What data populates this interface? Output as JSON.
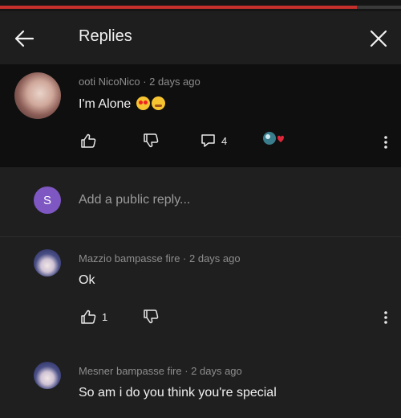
{
  "header": {
    "title": "Replies",
    "back_icon": "arrow-left-icon",
    "close_icon": "close-icon"
  },
  "video_progress": {
    "played_fraction": 0.89
  },
  "parent_comment": {
    "meta": "ooti NicoNico · 2 days ago",
    "text": "I'm Alone",
    "emojis": [
      "heart-eyes-emoji",
      "hot-face-emoji"
    ],
    "reply_count": "4"
  },
  "reply_input": {
    "avatar_letter": "S",
    "placeholder": "Add a public reply..."
  },
  "replies": [
    {
      "meta": "Mazzio bampasse fire · 2 days ago",
      "text": "Ok",
      "like_count": "1"
    },
    {
      "meta": "Mesner bampasse fire · 2 days ago",
      "text": "So am i do you think you're special"
    }
  ],
  "colors": {
    "background": "#1f1f1f",
    "parent_background": "#0f0f0f",
    "progress_red": "#c4302b",
    "avatar_purple": "#7e57c2"
  }
}
